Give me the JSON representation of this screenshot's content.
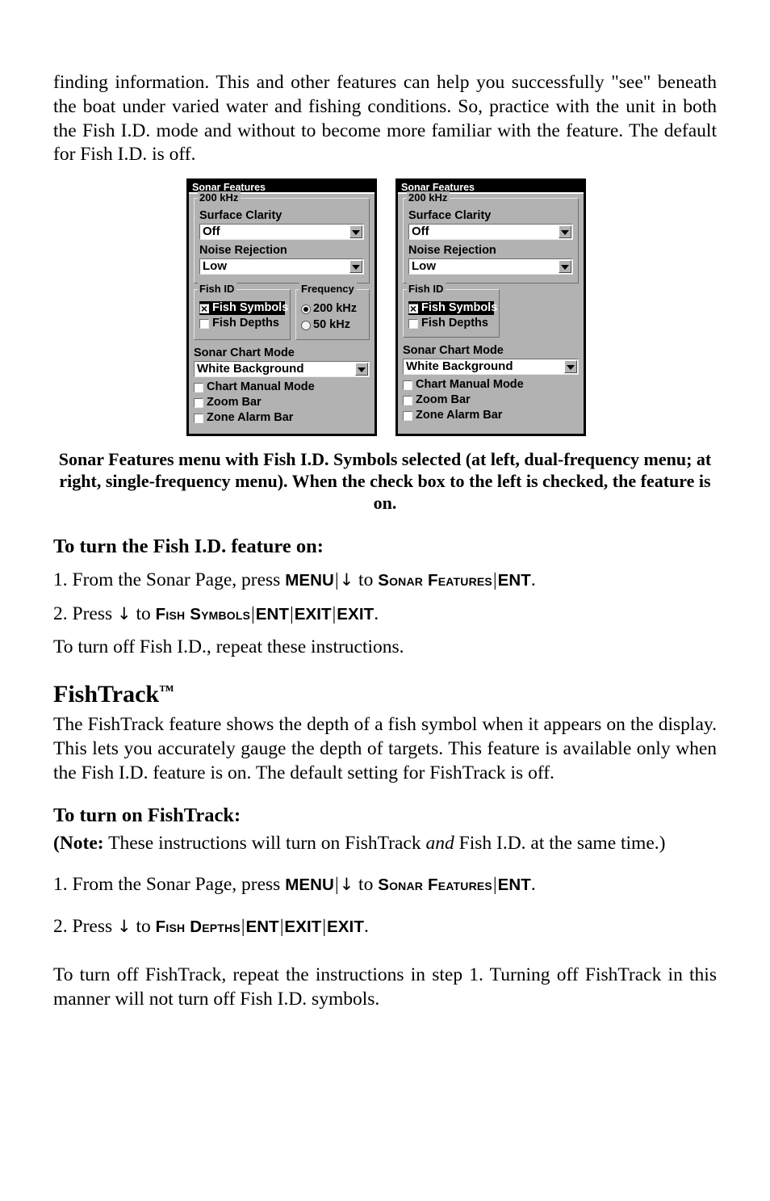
{
  "paragraphs": {
    "intro": "finding information. This and other features can help you successfully \"see\" beneath the boat under varied water and fishing conditions. So, practice with the unit in both the Fish I.D. mode and without to become more familiar with the feature. The default for Fish I.D. is off.",
    "caption": "Sonar Features menu with Fish I.D. Symbols selected (at left, dual-frequency menu; at right, single-frequency menu). When the check box to the left is checked, the feature is on.",
    "fishid_heading": "To turn the Fish I.D. feature on:",
    "fishid_step1_pre": "1. From the Sonar Page, press ",
    "fishid_step1_key1": "MENU",
    "fishid_step1_mid": " to ",
    "fishid_step1_key2": "Sonar Features",
    "fishid_step1_key3": "ENT",
    "fishid_step1_end": ".",
    "fishid_step2_pre": "2. Press ",
    "fishid_step2_mid": " to ",
    "fishid_step2_key1": "Fish Symbols",
    "fishid_step2_key2": "ENT",
    "fishid_step2_key3": "EXIT",
    "fishid_step2_key4": "EXIT",
    "fishid_step2_end": ".",
    "fishid_repeat": "To turn off Fish I.D., repeat these instructions.",
    "fishtrack_title": "FishTrack",
    "fishtrack_tm": "™",
    "fishtrack_body": "The FishTrack feature shows the depth of a fish symbol when it appears on the display. This lets you accurately gauge the depth of targets. This feature is available only when the Fish I.D. feature is on. The default setting for FishTrack is off.",
    "fishtrack_heading": "To turn on FishTrack:",
    "note_label": "(Note:",
    "note_pre": " These instructions will turn on FishTrack ",
    "note_italic": "and",
    "note_post": " Fish I.D. at the same time.)",
    "ft_step1_pre": "1. From the Sonar Page, press ",
    "ft_step1_key1": "MENU",
    "ft_step1_mid": " to ",
    "ft_step1_key2": "Sonar Features",
    "ft_step1_key3": "ENT",
    "ft_step1_end": ".",
    "ft_step2_pre": "2. Press ",
    "ft_step2_mid": " to ",
    "ft_step2_key1": "Fish Depths",
    "ft_step2_key2": "ENT",
    "ft_step2_key3": "EXIT",
    "ft_step2_key4": "EXIT",
    "ft_step2_end": ".",
    "closing": "To turn off FishTrack, repeat the instructions in step 1. Turning off FishTrack in this manner will not turn off Fish I.D. symbols."
  },
  "symbols": {
    "down_arrow": "↓",
    "pipe": "|"
  },
  "colors": {
    "dialog_background": "#b2b2b2",
    "titlebar_background": "#000000",
    "titlebar_text": "#ffffff",
    "field_background": "#ffffff",
    "selection_background": "#000000",
    "selection_text": "#ffffff",
    "page_background": "#ffffff",
    "text": "#000000"
  },
  "dialogs": [
    {
      "id": "dual-frequency",
      "title": "Sonar Features",
      "frequency_group_label": "200 kHz",
      "surface_clarity_label": "Surface Clarity",
      "surface_clarity_value": "Off",
      "noise_rejection_label": "Noise Rejection",
      "noise_rejection_value": "Low",
      "fish_id_label": "Fish ID",
      "fish_symbols_label": "Fish Symbols",
      "fish_symbols_checked": true,
      "fish_symbols_selected": true,
      "fish_depths_label": "Fish Depths",
      "fish_depths_checked": false,
      "has_frequency_box": true,
      "frequency_label": "Frequency",
      "freq_200_label": "200 kHz",
      "freq_200_selected": true,
      "freq_50_label": "50 kHz",
      "freq_50_selected": false,
      "sonar_chart_mode_label": "Sonar Chart Mode",
      "sonar_chart_mode_value": "White Background",
      "chart_manual_mode_label": "Chart Manual Mode",
      "chart_manual_mode_checked": false,
      "zoom_bar_label": "Zoom Bar",
      "zoom_bar_checked": false,
      "zone_alarm_bar_label": "Zone Alarm Bar",
      "zone_alarm_bar_checked": false
    },
    {
      "id": "single-frequency",
      "title": "Sonar Features",
      "frequency_group_label": "200 kHz",
      "surface_clarity_label": "Surface Clarity",
      "surface_clarity_value": "Off",
      "noise_rejection_label": "Noise Rejection",
      "noise_rejection_value": "Low",
      "fish_id_label": "Fish ID",
      "fish_symbols_label": "Fish Symbols",
      "fish_symbols_checked": true,
      "fish_symbols_selected": true,
      "fish_depths_label": "Fish Depths",
      "fish_depths_checked": false,
      "has_frequency_box": false,
      "sonar_chart_mode_label": "Sonar Chart Mode",
      "sonar_chart_mode_value": "White Background",
      "chart_manual_mode_label": "Chart Manual Mode",
      "chart_manual_mode_checked": false,
      "zoom_bar_label": "Zoom Bar",
      "zoom_bar_checked": false,
      "zone_alarm_bar_label": "Zone Alarm Bar",
      "zone_alarm_bar_checked": false
    }
  ]
}
